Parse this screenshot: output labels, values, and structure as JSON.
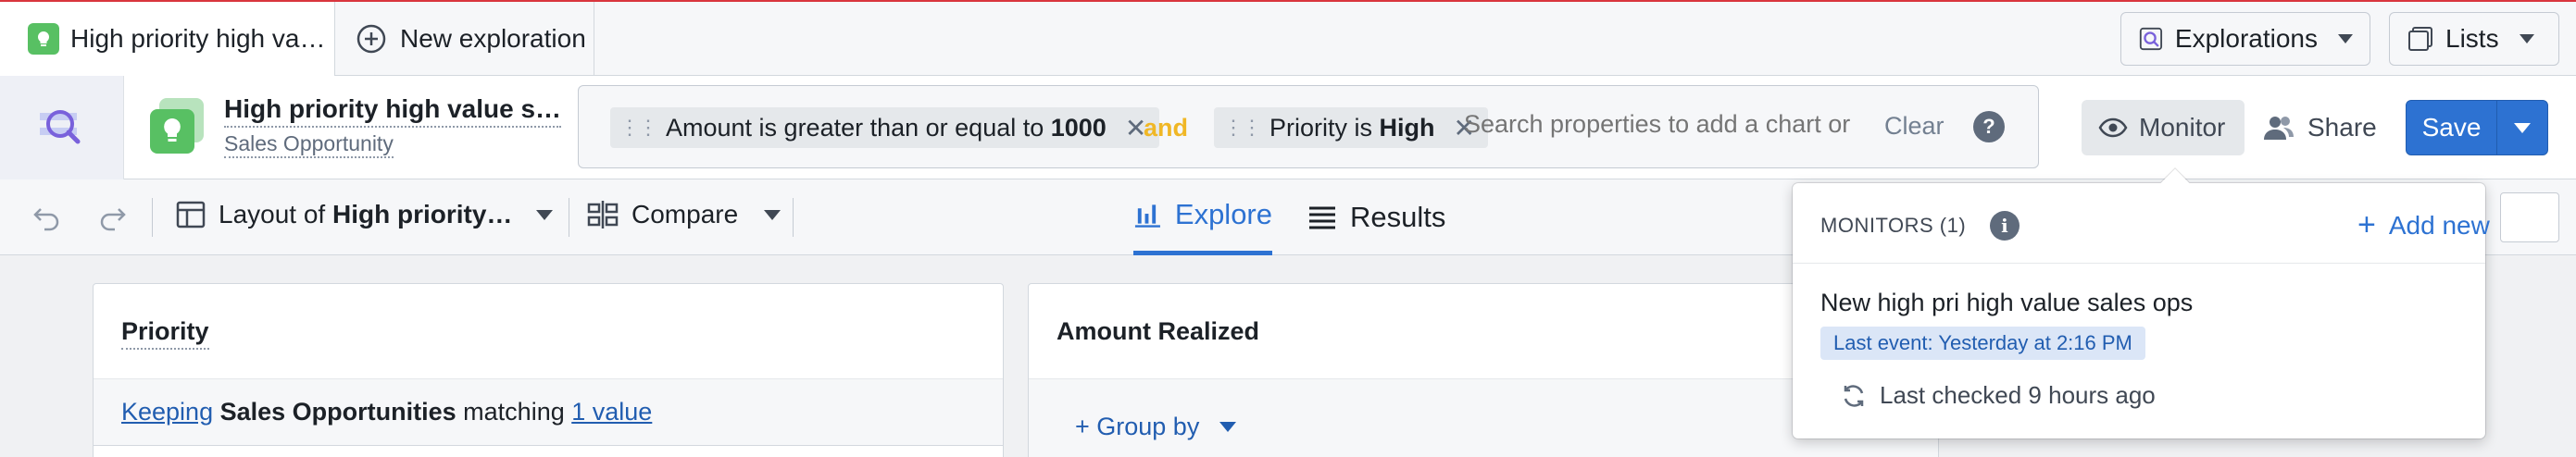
{
  "tabs": {
    "active_label": "High priority high va…",
    "new_label": "New exploration"
  },
  "topbar": {
    "explorations_label": "Explorations",
    "lists_label": "Lists"
  },
  "object": {
    "title": "High priority high value s…",
    "type": "Sales Opportunity"
  },
  "filters": {
    "chip1": {
      "prefix": "Amount is greater than or equal to ",
      "value": "1000"
    },
    "connector": "and",
    "chip2": {
      "prefix": "Priority is ",
      "value": "High"
    },
    "search_placeholder": "Search properties to add a chart or f",
    "clear_label": "Clear",
    "help_label": "?"
  },
  "actions": {
    "monitor_label": "Monitor",
    "share_label": "Share",
    "save_label": "Save"
  },
  "toolbar": {
    "layout_prefix": "Layout of ",
    "layout_name": "High priority…",
    "compare_label": "Compare",
    "explore_label": "Explore",
    "results_label": "Results"
  },
  "cards": {
    "priority": {
      "title": "Priority",
      "keeping_link": "Keeping",
      "object_plural": "Sales Opportunities",
      "matching_text": " matching ",
      "value_link": "1 value"
    },
    "amount": {
      "title": "Amount Realized",
      "groupby_label": "+ Group by"
    }
  },
  "monitors_popover": {
    "heading": "MONITORS (1)",
    "info_label": "i",
    "add_new_label": "Add new",
    "monitor_name": "New high pri high value sales ops",
    "last_event": "Last event: Yesterday at 2:16 PM",
    "last_checked": "Last checked 9 hours ago"
  },
  "colors": {
    "accent": "#2d72d2",
    "and_connector": "#f0b726",
    "object_icon": "#58c063",
    "top_border": "#d9363e"
  }
}
